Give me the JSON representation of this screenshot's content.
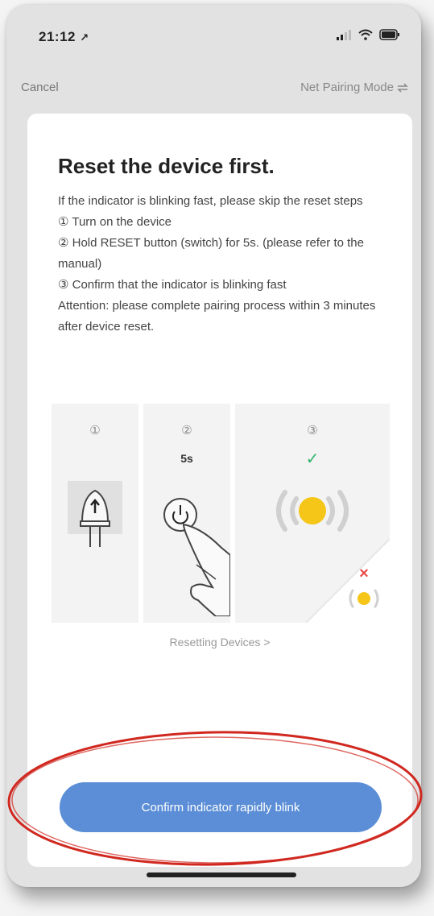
{
  "status_bar": {
    "time": "21:12",
    "time_arrow": "↗"
  },
  "nav": {
    "cancel_label": "Cancel",
    "mode_label": "Net Pairing Mode",
    "mode_icon": "swap-icon"
  },
  "card": {
    "title": "Reset the device first.",
    "instructions": [
      "If the indicator is blinking fast, please skip the reset steps",
      "① Turn on the device",
      "② Hold RESET button (switch) for 5s. (please refer to the manual)",
      "③ Confirm that the indicator is blinking fast",
      "Attention: please complete pairing process within 3 minutes after device reset."
    ],
    "steps": [
      {
        "num": "①"
      },
      {
        "num": "②",
        "sub": "5s"
      },
      {
        "num": "③",
        "check": "✓",
        "cross": "×"
      }
    ],
    "resetting_link": "Resetting Devices >",
    "confirm_button": "Confirm indicator rapidly blink"
  },
  "colors": {
    "accent": "#5b8ed6",
    "indicator": "#f5c518",
    "check": "#2fb36a",
    "cross": "#e84a4a",
    "highlight_ring": "#d0281f"
  }
}
